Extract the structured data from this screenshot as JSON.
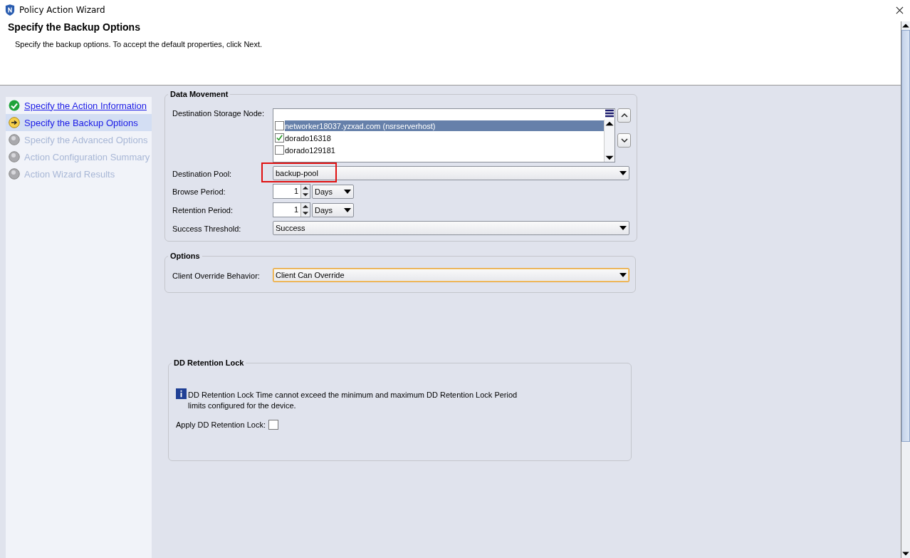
{
  "window": {
    "title": "Policy Action Wizard"
  },
  "header": {
    "title": "Specify the Backup Options",
    "description": "Specify the backup options. To accept the default properties, click Next."
  },
  "steps": [
    {
      "label": "Specify the Action Information",
      "kind": "done",
      "selected": false
    },
    {
      "label": "Specify the Backup Options",
      "kind": "current",
      "selected": true
    },
    {
      "label": "Specify the Advanced Options",
      "kind": "pending",
      "selected": false
    },
    {
      "label": "Action Configuration Summary",
      "kind": "pending",
      "selected": false
    },
    {
      "label": "Action Wizard Results",
      "kind": "pending",
      "selected": false
    }
  ],
  "data_movement": {
    "title": "Data Movement",
    "storage_node_label": "Destination Storage Node:",
    "storage_nodes": [
      {
        "name": "networker18037.yzxad.com (nsrserverhost)",
        "checked": false,
        "selected": true
      },
      {
        "name": "dorado16318",
        "checked": true,
        "selected": false
      },
      {
        "name": "dorado129181",
        "checked": false,
        "selected": false
      }
    ],
    "pool_label": "Destination Pool:",
    "pool": "backup-pool",
    "pool_highlighted": true,
    "browse_label": "Browse Period:",
    "browse_value": "1",
    "browse_unit": "Days",
    "retention_label": "Retention Period:",
    "retention_value": "1",
    "retention_unit": "Days",
    "threshold_label": "Success Threshold:",
    "threshold": "Success"
  },
  "options": {
    "title": "Options",
    "override_label": "Client Override Behavior:",
    "override": "Client Can Override",
    "override_focused": true
  },
  "retention_lock": {
    "title": "DD Retention Lock",
    "info": "DD Retention Lock Time cannot exceed the minimum and maximum DD Retention Lock Period limits configured for the device.",
    "apply_label": "Apply DD Retention Lock:",
    "apply_checked": false
  }
}
